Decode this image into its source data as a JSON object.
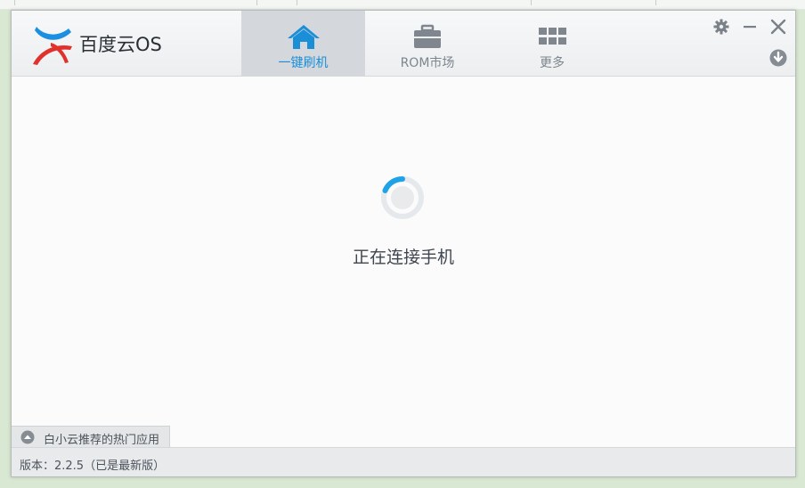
{
  "app": {
    "brand": "百度云OS"
  },
  "tabs": [
    {
      "label": "一键刷机",
      "icon": "home-icon",
      "active": true
    },
    {
      "label": "ROM市场",
      "icon": "briefcase-icon",
      "active": false
    },
    {
      "label": "更多",
      "icon": "grid-icon",
      "active": false
    }
  ],
  "window_controls": {
    "settings": "gear-icon",
    "minimize": "minimize-icon",
    "close": "close-icon",
    "download": "download-icon"
  },
  "main": {
    "status": "正在连接手机"
  },
  "recommend": {
    "label": "白小云推荐的热门应用",
    "icon": "chevron-up-icon"
  },
  "footer": {
    "version": "版本：2.2.5（已是最新版）"
  },
  "colors": {
    "accent": "#1a8fd8",
    "logo_blue": "#1b8fe0",
    "logo_red": "#e0312b",
    "tab_active_bg": "#d4d7dc"
  }
}
